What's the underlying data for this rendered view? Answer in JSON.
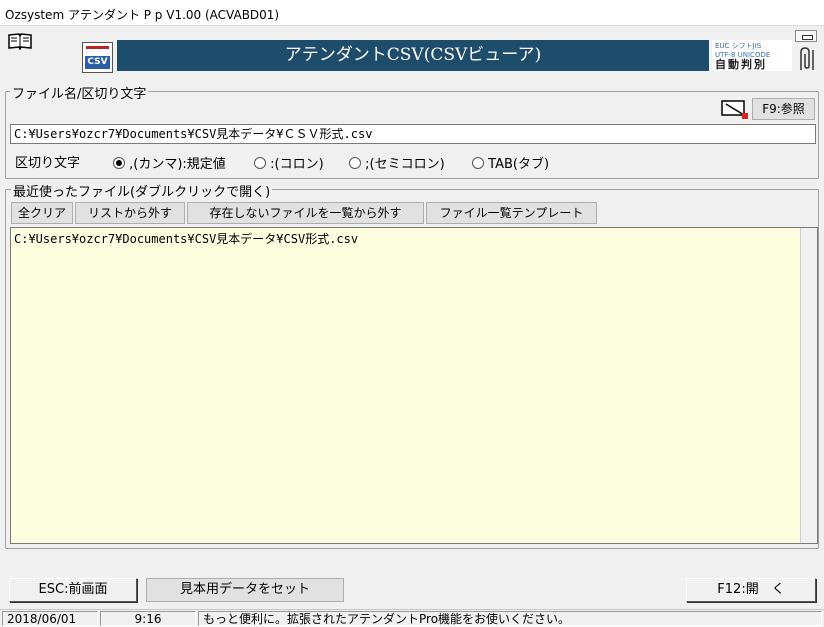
{
  "window": {
    "title": "Ozsystem アテンダント P p V1.00 (ACVABD01)"
  },
  "header": {
    "banner_title": "アテンダントCSV(CSVビューア)",
    "icon_label": "CSV",
    "encoding_line1": "EUC シフトJIS",
    "encoding_line2": "UTF-8 UNICODE",
    "encoding_line3": "自動判別"
  },
  "file_section": {
    "legend": "ファイル名/区切り文字",
    "browse_button": "F9:参照",
    "path_value": "C:¥Users¥ozcr7¥Documents¥CSV見本データ¥ＣＳＶ形式.csv",
    "delimiter_label": "区切り文字",
    "options": [
      {
        "label": ",(カンマ):規定値",
        "selected": true
      },
      {
        "label": ":(コロン)",
        "selected": false
      },
      {
        "label": ";(セミコロン)",
        "selected": false
      },
      {
        "label": "TAB(タブ)",
        "selected": false
      }
    ]
  },
  "recent_section": {
    "legend": "最近使ったファイル(ダブルクリックで開く)",
    "buttons": [
      "全クリア",
      "リストから外す",
      "存在しないファイルを一覧から外す",
      "ファイル一覧テンプレート"
    ],
    "items": [
      "C:¥Users¥ozcr7¥Documents¥CSV見本データ¥CSV形式.csv"
    ]
  },
  "footer": {
    "back_button": "ESC:前画面",
    "sample_button": "見本用データをセット",
    "open_button": "F12:開　く"
  },
  "status": {
    "date": "2018/06/01",
    "time": "9:16",
    "message": "もっと便利に。拡張されたアテンダントPro機能をお使いください。"
  }
}
